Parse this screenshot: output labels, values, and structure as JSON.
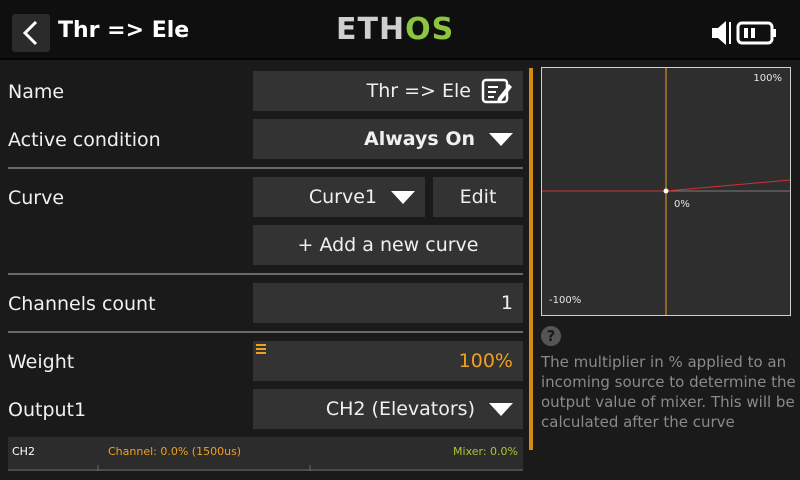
{
  "header": {
    "title": "Thr => Ele",
    "logo_left": "ETH",
    "logo_right": "OS",
    "icons": [
      "back-chevron-icon",
      "volume-icon",
      "battery-icon"
    ]
  },
  "form": {
    "name_label": "Name",
    "name_value": "Thr => Ele",
    "active_label": "Active condition",
    "active_value": "Always On",
    "curve_label": "Curve",
    "curve_value": "Curve1",
    "edit_label": "Edit",
    "add_curve_label": "+ Add a new curve",
    "channels_label": "Channels count",
    "channels_value": "1",
    "weight_label": "Weight",
    "weight_value": "100%",
    "output_label": "Output1",
    "output_value": "CH2 (Elevators)"
  },
  "footer": {
    "channel_name": "CH2",
    "channel_text": "Channel: 0.0% (1500us)",
    "mixer_text": "Mixer: 0.0%"
  },
  "curve_preview": {
    "top_label": "100%",
    "center_label": "0%",
    "bottom_label": "-100%"
  },
  "help": {
    "icon": "question-icon",
    "text": "The multiplier in % applied to an incoming source to determine the output value of mixer. This will be calculated after the curve"
  },
  "colors": {
    "accent": "#f0a020",
    "logo_green": "#8cc63f",
    "mixer_green": "#a7c83a",
    "curve_red": "#d33030"
  }
}
